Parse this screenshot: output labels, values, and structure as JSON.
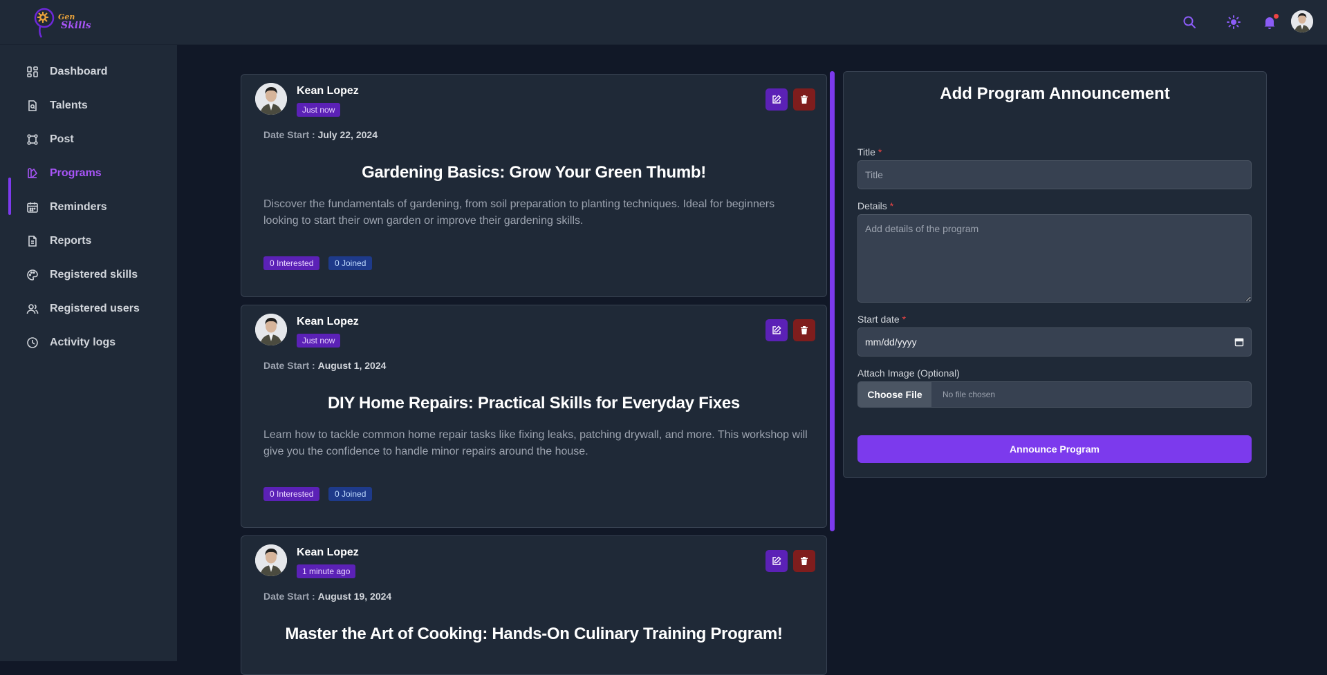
{
  "header": {
    "logo_line1": "Gen",
    "logo_line2": "Skills"
  },
  "sidebar": {
    "items": [
      {
        "label": "Dashboard",
        "icon": "dashboard-icon"
      },
      {
        "label": "Talents",
        "icon": "talents-icon"
      },
      {
        "label": "Post",
        "icon": "post-icon"
      },
      {
        "label": "Programs",
        "icon": "programs-icon",
        "active": true
      },
      {
        "label": "Reminders",
        "icon": "calendar-icon"
      },
      {
        "label": "Reports",
        "icon": "reports-icon"
      },
      {
        "label": "Registered skills",
        "icon": "palette-icon"
      },
      {
        "label": "Registered users",
        "icon": "users-icon"
      },
      {
        "label": "Activity logs",
        "icon": "clock-icon"
      }
    ]
  },
  "posts": [
    {
      "author": "Kean Lopez",
      "time": "Just now",
      "date_label": "Date Start :",
      "date": "July 22, 2024",
      "title": "Gardening Basics: Grow Your Green Thumb!",
      "description": "Discover the fundamentals of gardening, from soil preparation to planting techniques. Ideal for beginners looking to start their own garden or improve their gardening skills.",
      "interested": "0 Interested",
      "joined": "0 Joined"
    },
    {
      "author": "Kean Lopez",
      "time": "Just now",
      "date_label": "Date Start :",
      "date": "August 1, 2024",
      "title": "DIY Home Repairs: Practical Skills for Everyday Fixes",
      "description": "Learn how to tackle common home repair tasks like fixing leaks, patching drywall, and more. This workshop will give you the confidence to handle minor repairs around the house.",
      "interested": "0 Interested",
      "joined": "0 Joined"
    },
    {
      "author": "Kean Lopez",
      "time": "1 minute ago",
      "date_label": "Date Start :",
      "date": "August 19, 2024",
      "title": "Master the Art of Cooking: Hands-On Culinary Training Program!"
    }
  ],
  "form": {
    "heading": "Add Program Announcement",
    "title_label": "Title",
    "title_placeholder": "Title",
    "details_label": "Details",
    "details_placeholder": "Add details of the program",
    "start_label": "Start date",
    "start_value": "mm/dd/yyyy",
    "image_label": "Attach Image (Optional)",
    "choose_file": "Choose File",
    "no_file": "No file chosen",
    "submit": "Announce Program",
    "required_mark": "*"
  },
  "colors": {
    "accent": "#7c3aed",
    "background": "#111827",
    "panel": "#1f2937",
    "danger": "#7f1d1d"
  }
}
